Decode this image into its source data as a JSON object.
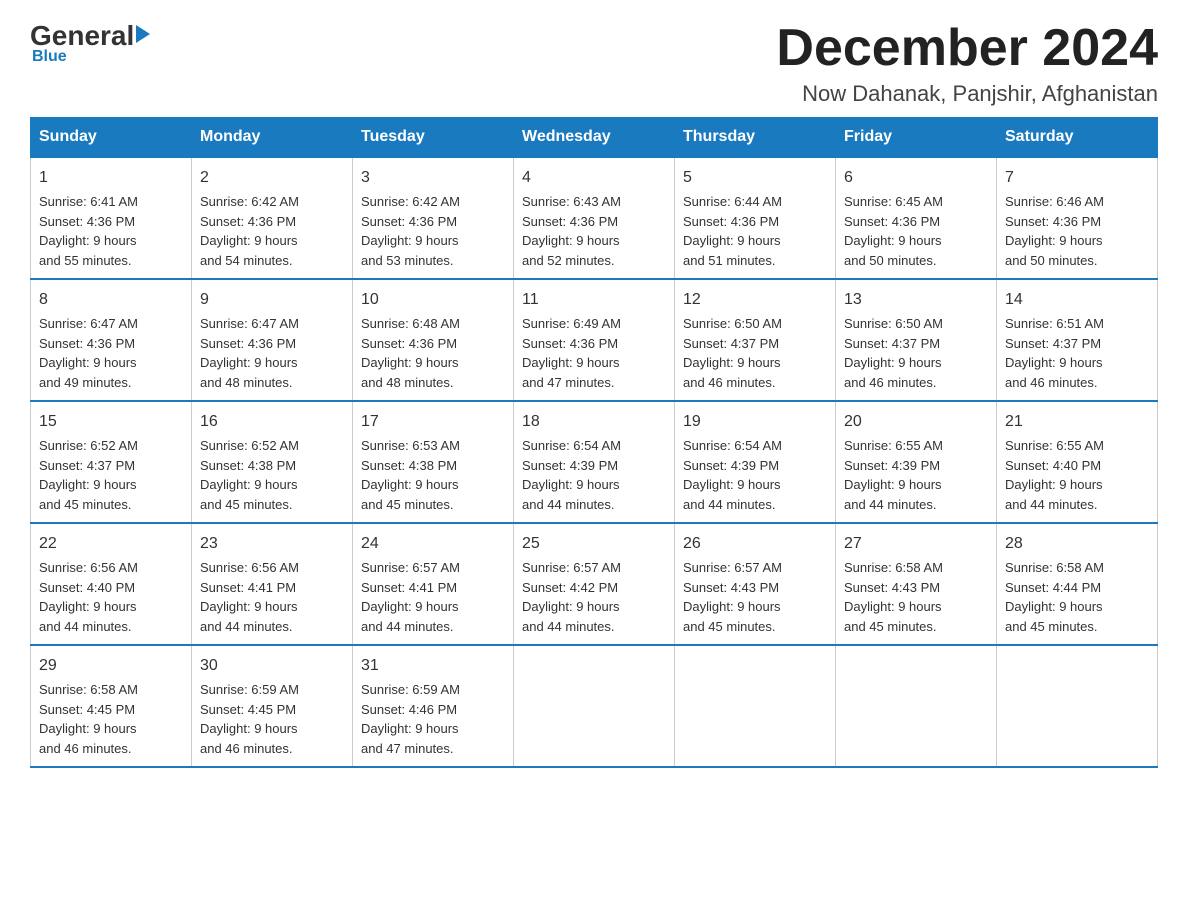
{
  "header": {
    "logo": {
      "general": "General",
      "blue": "Blue",
      "underline": "Blue"
    },
    "title": "December 2024",
    "location": "Now Dahanak, Panjshir, Afghanistan"
  },
  "calendar": {
    "days_of_week": [
      "Sunday",
      "Monday",
      "Tuesday",
      "Wednesday",
      "Thursday",
      "Friday",
      "Saturday"
    ],
    "weeks": [
      [
        {
          "day": "1",
          "sunrise": "6:41 AM",
          "sunset": "4:36 PM",
          "daylight": "9 hours and 55 minutes."
        },
        {
          "day": "2",
          "sunrise": "6:42 AM",
          "sunset": "4:36 PM",
          "daylight": "9 hours and 54 minutes."
        },
        {
          "day": "3",
          "sunrise": "6:42 AM",
          "sunset": "4:36 PM",
          "daylight": "9 hours and 53 minutes."
        },
        {
          "day": "4",
          "sunrise": "6:43 AM",
          "sunset": "4:36 PM",
          "daylight": "9 hours and 52 minutes."
        },
        {
          "day": "5",
          "sunrise": "6:44 AM",
          "sunset": "4:36 PM",
          "daylight": "9 hours and 51 minutes."
        },
        {
          "day": "6",
          "sunrise": "6:45 AM",
          "sunset": "4:36 PM",
          "daylight": "9 hours and 50 minutes."
        },
        {
          "day": "7",
          "sunrise": "6:46 AM",
          "sunset": "4:36 PM",
          "daylight": "9 hours and 50 minutes."
        }
      ],
      [
        {
          "day": "8",
          "sunrise": "6:47 AM",
          "sunset": "4:36 PM",
          "daylight": "9 hours and 49 minutes."
        },
        {
          "day": "9",
          "sunrise": "6:47 AM",
          "sunset": "4:36 PM",
          "daylight": "9 hours and 48 minutes."
        },
        {
          "day": "10",
          "sunrise": "6:48 AM",
          "sunset": "4:36 PM",
          "daylight": "9 hours and 48 minutes."
        },
        {
          "day": "11",
          "sunrise": "6:49 AM",
          "sunset": "4:36 PM",
          "daylight": "9 hours and 47 minutes."
        },
        {
          "day": "12",
          "sunrise": "6:50 AM",
          "sunset": "4:37 PM",
          "daylight": "9 hours and 46 minutes."
        },
        {
          "day": "13",
          "sunrise": "6:50 AM",
          "sunset": "4:37 PM",
          "daylight": "9 hours and 46 minutes."
        },
        {
          "day": "14",
          "sunrise": "6:51 AM",
          "sunset": "4:37 PM",
          "daylight": "9 hours and 46 minutes."
        }
      ],
      [
        {
          "day": "15",
          "sunrise": "6:52 AM",
          "sunset": "4:37 PM",
          "daylight": "9 hours and 45 minutes."
        },
        {
          "day": "16",
          "sunrise": "6:52 AM",
          "sunset": "4:38 PM",
          "daylight": "9 hours and 45 minutes."
        },
        {
          "day": "17",
          "sunrise": "6:53 AM",
          "sunset": "4:38 PM",
          "daylight": "9 hours and 45 minutes."
        },
        {
          "day": "18",
          "sunrise": "6:54 AM",
          "sunset": "4:39 PM",
          "daylight": "9 hours and 44 minutes."
        },
        {
          "day": "19",
          "sunrise": "6:54 AM",
          "sunset": "4:39 PM",
          "daylight": "9 hours and 44 minutes."
        },
        {
          "day": "20",
          "sunrise": "6:55 AM",
          "sunset": "4:39 PM",
          "daylight": "9 hours and 44 minutes."
        },
        {
          "day": "21",
          "sunrise": "6:55 AM",
          "sunset": "4:40 PM",
          "daylight": "9 hours and 44 minutes."
        }
      ],
      [
        {
          "day": "22",
          "sunrise": "6:56 AM",
          "sunset": "4:40 PM",
          "daylight": "9 hours and 44 minutes."
        },
        {
          "day": "23",
          "sunrise": "6:56 AM",
          "sunset": "4:41 PM",
          "daylight": "9 hours and 44 minutes."
        },
        {
          "day": "24",
          "sunrise": "6:57 AM",
          "sunset": "4:41 PM",
          "daylight": "9 hours and 44 minutes."
        },
        {
          "day": "25",
          "sunrise": "6:57 AM",
          "sunset": "4:42 PM",
          "daylight": "9 hours and 44 minutes."
        },
        {
          "day": "26",
          "sunrise": "6:57 AM",
          "sunset": "4:43 PM",
          "daylight": "9 hours and 45 minutes."
        },
        {
          "day": "27",
          "sunrise": "6:58 AM",
          "sunset": "4:43 PM",
          "daylight": "9 hours and 45 minutes."
        },
        {
          "day": "28",
          "sunrise": "6:58 AM",
          "sunset": "4:44 PM",
          "daylight": "9 hours and 45 minutes."
        }
      ],
      [
        {
          "day": "29",
          "sunrise": "6:58 AM",
          "sunset": "4:45 PM",
          "daylight": "9 hours and 46 minutes."
        },
        {
          "day": "30",
          "sunrise": "6:59 AM",
          "sunset": "4:45 PM",
          "daylight": "9 hours and 46 minutes."
        },
        {
          "day": "31",
          "sunrise": "6:59 AM",
          "sunset": "4:46 PM",
          "daylight": "9 hours and 47 minutes."
        },
        null,
        null,
        null,
        null
      ]
    ],
    "labels": {
      "sunrise": "Sunrise:",
      "sunset": "Sunset:",
      "daylight": "Daylight:"
    }
  }
}
